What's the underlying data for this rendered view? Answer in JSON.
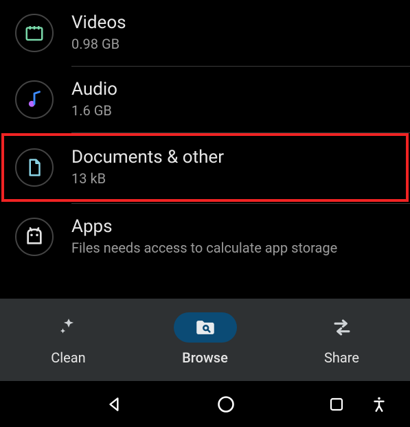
{
  "categories": [
    {
      "id": "videos",
      "title": "Videos",
      "sub": "0.98 GB",
      "icon": "videos-icon",
      "highlighted": false
    },
    {
      "id": "audio",
      "title": "Audio",
      "sub": "1.6 GB",
      "icon": "audio-icon",
      "highlighted": false
    },
    {
      "id": "documents",
      "title": "Documents & other",
      "sub": "13 kB",
      "icon": "documents-icon",
      "highlighted": true
    },
    {
      "id": "apps",
      "title": "Apps",
      "sub": "Files needs access to calculate app storage",
      "icon": "apps-icon",
      "highlighted": false
    }
  ],
  "bottom_bar": {
    "clean": {
      "label": "Clean",
      "active": false
    },
    "browse": {
      "label": "Browse",
      "active": true
    },
    "share": {
      "label": "Share",
      "active": false
    }
  },
  "colors": {
    "videos": "#79d8a9",
    "audio_note": "#b868ff",
    "audio_stem": "#3d8bff",
    "documents": "#8bd4e6",
    "apps": "#e3e3e3",
    "highlight_border": "#f02323",
    "browse_active_bg": "#0b4b75"
  }
}
